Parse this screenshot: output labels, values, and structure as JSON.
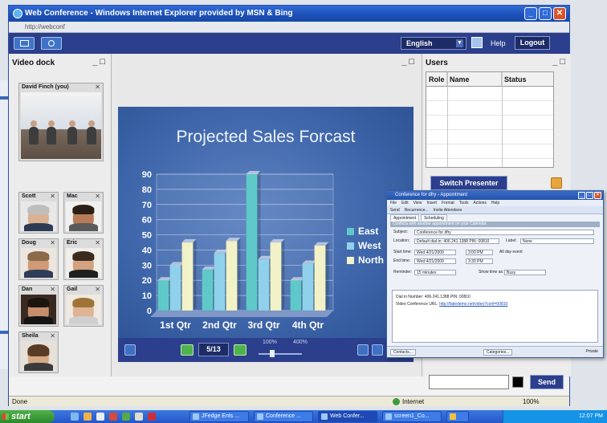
{
  "browser": {
    "title": "Web Conference - Windows Internet Explorer provided by MSN & Bing",
    "address": "http://webconf"
  },
  "appbar": {
    "language": "English",
    "help": "Help",
    "logout": "Logout"
  },
  "video_dock": {
    "title": "Video dock",
    "main_tile": "David Finch (you)",
    "tiles": [
      "Scott",
      "Mac",
      "Doug",
      "Eric",
      "Dan",
      "Gail",
      "Sheila"
    ]
  },
  "slide": {
    "title": "Projected Sales Forcast",
    "page": "5/13",
    "zoom_min": "100%",
    "zoom_max": "400%"
  },
  "chart_data": {
    "type": "bar",
    "title": "Projected Sales Forcast",
    "categories": [
      "1st Qtr",
      "2nd Qtr",
      "3rd Qtr",
      "4th Qtr"
    ],
    "series": [
      {
        "name": "East",
        "values": [
          20,
          27,
          90,
          20
        ],
        "color": "#5fc9c9"
      },
      {
        "name": "West",
        "values": [
          30,
          38,
          34,
          31
        ],
        "color": "#8fd1ea"
      },
      {
        "name": "North",
        "values": [
          45,
          46,
          45,
          43
        ],
        "color": "#f2f2c8"
      }
    ],
    "ylim": [
      0,
      90
    ],
    "yticks": [
      "0",
      "10",
      "20",
      "30",
      "40",
      "50",
      "60",
      "70",
      "80",
      "90"
    ],
    "legend": "right",
    "grid": true
  },
  "users": {
    "title": "Users",
    "columns": [
      "Role",
      "Name",
      "Status"
    ],
    "switch_presenter": "Switch Presenter",
    "send": "Send"
  },
  "appointment": {
    "title": "Conference for dfry - Appointment",
    "menu": [
      "File",
      "Edit",
      "View",
      "Insert",
      "Format",
      "Tools",
      "Actions",
      "Help"
    ],
    "tools": [
      "Send",
      "Recurrence...",
      "Invite Attendees"
    ],
    "tabs": [
      "Appointment",
      "Scheduling"
    ],
    "info": "Conflicts with another appointment on your Calendar.",
    "subject_label": "Subject:",
    "subject": "Conference for dfry",
    "location_label": "Location:",
    "location": "Default dial-in: 406.241.1388 PIN: 00810",
    "label_label": "Label:",
    "label_value": "None",
    "start_label": "Start time:",
    "start_date": "Wed 4/21/2009",
    "start_time": "3:00 PM",
    "allday": "All day event",
    "end_label": "End time:",
    "end_date": "Wed 4/21/2009",
    "end_time": "3:30 PM",
    "reminder": "Reminder:",
    "reminder_value": "15 minutes",
    "showtime": "Show time as:",
    "showtime_value": "Busy",
    "body_line1": "Dial in Number: 406.241.1388   PIN: 00810",
    "body_line2": "Video Conference URL:",
    "body_link": "http://fakedemo.net/video?conf=00810",
    "contacts": "Contacts...",
    "categories": "Categories...",
    "private": "Private"
  },
  "status": {
    "text": "Done",
    "zone": "Internet",
    "zoom": "100%"
  },
  "taskbar": {
    "start": "start",
    "tasks": [
      "JFedge Ents ...",
      "Conference ...",
      "Web Confer...",
      "screen1_Co..."
    ],
    "clock": "12:07 PM"
  }
}
